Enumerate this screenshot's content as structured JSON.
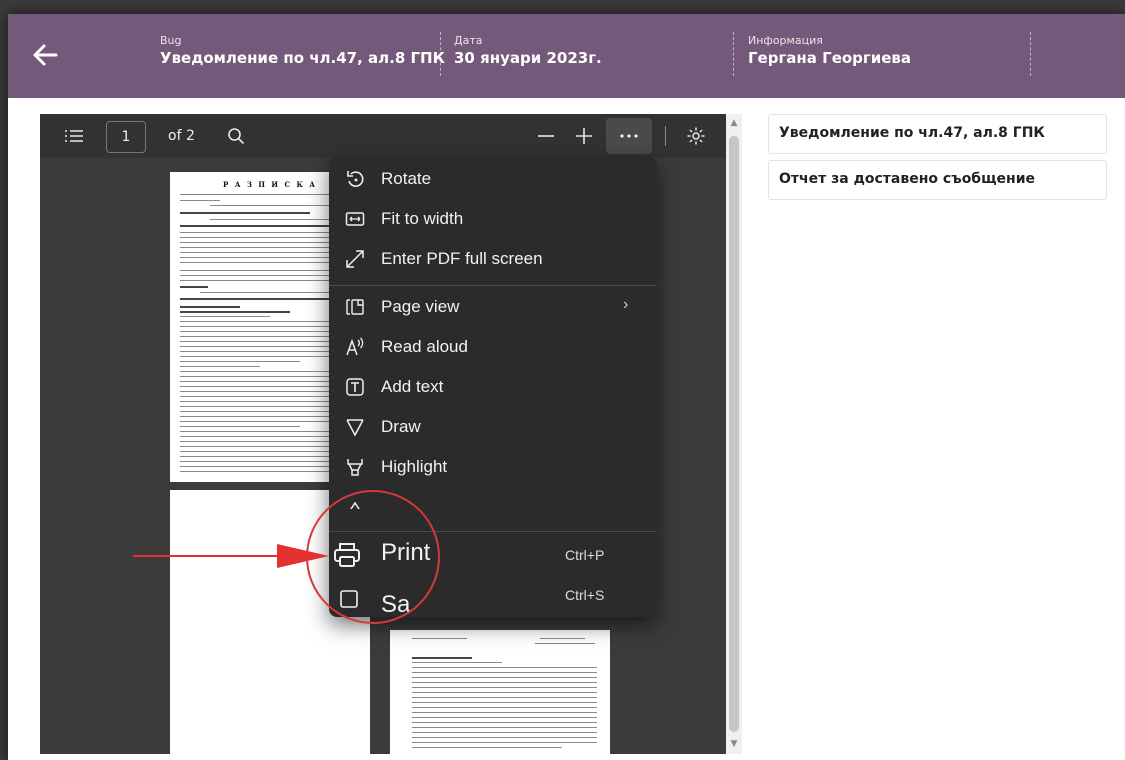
{
  "header": {
    "col1": {
      "label": "Bug",
      "value": "Уведомление по чл.47, ал.8 ГПК"
    },
    "col2": {
      "label": "Дата",
      "value": "30 януари 2023г."
    },
    "col3": {
      "label": "Информация",
      "value": "Гергана Георгиева"
    },
    "back_icon": "arrow-left-icon",
    "bg_color": "#75597a"
  },
  "toolbar": {
    "page_number": "1",
    "page_of": "of 2"
  },
  "document": {
    "page1_title": "Р А З П И С К А"
  },
  "menu": {
    "items": [
      {
        "label": "Rotate",
        "icon": "rotate-icon"
      },
      {
        "label": "Fit to width",
        "icon": "fit-width-icon"
      },
      {
        "label": "Enter PDF full screen",
        "icon": "fullscreen-icon"
      },
      {
        "label": "Page view",
        "icon": "page-view-icon"
      },
      {
        "label": "Read aloud",
        "icon": "read-aloud-icon"
      },
      {
        "label": "Add text",
        "icon": "add-text-icon"
      },
      {
        "label": "Draw",
        "icon": "draw-icon"
      },
      {
        "label": "Highlight",
        "icon": "highlight-icon"
      },
      {
        "label": "Print",
        "icon": "print-icon",
        "shortcut": "Ctrl+P"
      },
      {
        "label": "Sa",
        "icon": "save-icon",
        "shortcut": "Ctrl+S"
      }
    ]
  },
  "sidebar": {
    "items": [
      {
        "label": "Уведомление по чл.47, ал.8 ГПК"
      },
      {
        "label": "Отчет за доставено съобщение"
      }
    ]
  },
  "annotation": {
    "color": "#e53030"
  }
}
